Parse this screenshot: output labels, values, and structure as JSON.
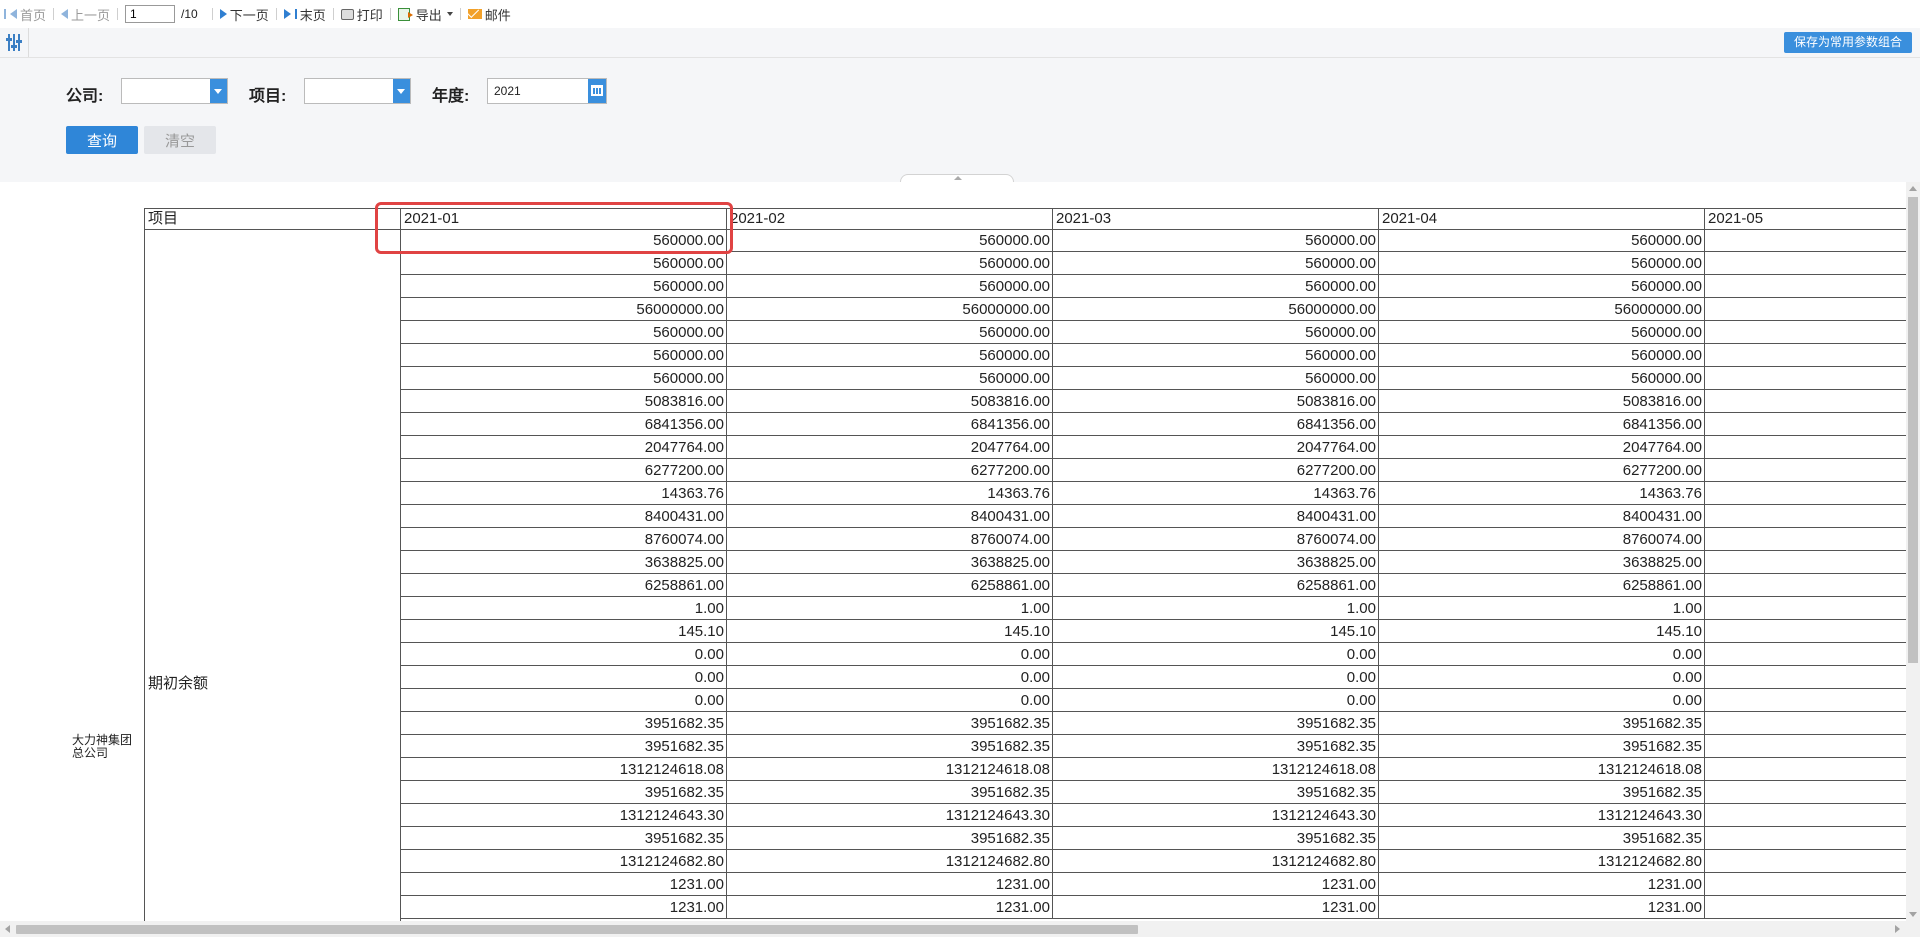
{
  "toolbar": {
    "first": "首页",
    "prev": "上一页",
    "page_value": "1",
    "page_total": "/10",
    "next": "下一页",
    "last": "末页",
    "print": "打印",
    "export": "导出",
    "mail": "邮件"
  },
  "params": {
    "save_label": "保存为常用参数组合"
  },
  "query": {
    "company_label": "公司:",
    "company_value": "",
    "item_label": "项目:",
    "item_value": "",
    "year_label": "年度:",
    "year_value": "2021",
    "query_btn": "查询",
    "clear_btn": "清空"
  },
  "report": {
    "company": "大力神集团总公司",
    "item_header": "项目",
    "item_value": "期初余额",
    "columns": [
      "2021-01",
      "2021-02",
      "2021-03",
      "2021-04",
      "2021-05"
    ],
    "rows": [
      "560000.00",
      "560000.00",
      "560000.00",
      "56000000.00",
      "560000.00",
      "560000.00",
      "560000.00",
      "5083816.00",
      "6841356.00",
      "2047764.00",
      "6277200.00",
      "14363.76",
      "8400431.00",
      "8760074.00",
      "3638825.00",
      "6258861.00",
      "1.00",
      "145.10",
      "0.00",
      "0.00",
      "0.00",
      "3951682.35",
      "3951682.35",
      "1312124618.08",
      "3951682.35",
      "1312124643.30",
      "3951682.35",
      "1312124682.80",
      "1231.00",
      "1231.00"
    ]
  }
}
